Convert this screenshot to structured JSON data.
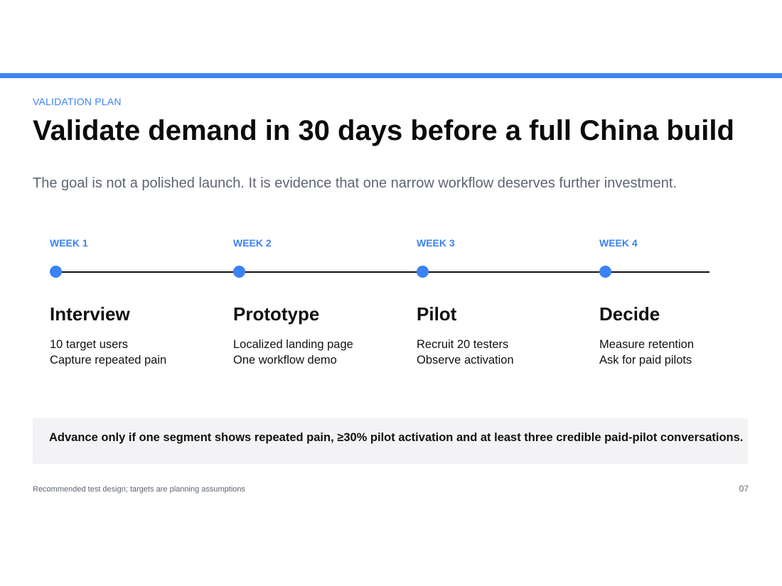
{
  "header": {
    "eyebrow": "VALIDATION PLAN",
    "title": "Validate demand in 30 days before a full China build",
    "subtitle": "The goal is not a polished launch. It is evidence that one narrow workflow deserves further investment."
  },
  "timeline": {
    "phases": [
      {
        "week": "WEEK 1",
        "title": "Interview",
        "lines": [
          "10 target users",
          "Capture repeated pain"
        ]
      },
      {
        "week": "WEEK 2",
        "title": "Prototype",
        "lines": [
          "Localized landing page",
          "One workflow demo"
        ]
      },
      {
        "week": "WEEK 3",
        "title": "Pilot",
        "lines": [
          "Recruit 20 testers",
          "Observe activation"
        ]
      },
      {
        "week": "WEEK 4",
        "title": "Decide",
        "lines": [
          "Measure retention",
          "Ask for paid pilots"
        ]
      }
    ]
  },
  "callout": {
    "text": "Advance only if one segment shows repeated pain, ≥30% pilot activation and at least three credible paid-pilot conversations."
  },
  "footer": {
    "note": "Recommended test design; targets are planning assumptions",
    "page_number": "07"
  },
  "colors": {
    "accent": "#3b82f6",
    "text": "#111111",
    "muted": "#5d6474",
    "callout_bg": "#f3f3f6"
  }
}
